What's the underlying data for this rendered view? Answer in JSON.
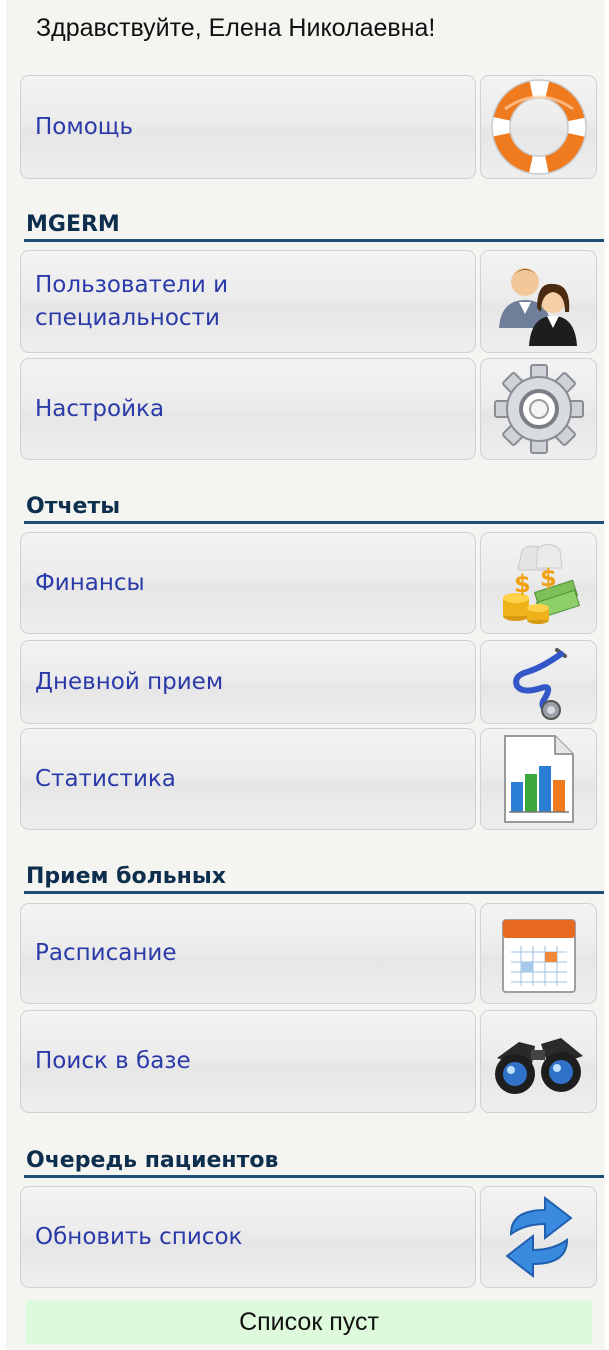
{
  "greeting": "Здравствуйте, Елена Николаевна!",
  "help": {
    "label": "Помощь",
    "icon": "lifebuoy-icon"
  },
  "sections": {
    "mgerm": {
      "title": "MGERM",
      "users": {
        "label": "Пользователи и специальности",
        "icon": "users-icon"
      },
      "settings": {
        "label": "Настройка",
        "icon": "gear-icon"
      }
    },
    "reports": {
      "title": "Отчеты",
      "finance": {
        "label": "Финансы",
        "icon": "money-icon"
      },
      "daily": {
        "label": "Дневной прием",
        "icon": "stethoscope-icon"
      },
      "stats": {
        "label": "Статистика",
        "icon": "bar-chart-icon"
      }
    },
    "reception": {
      "title": "Прием больных",
      "schedule": {
        "label": "Расписание",
        "icon": "calendar-icon"
      },
      "search": {
        "label": "Поиск в базе",
        "icon": "binoculars-icon"
      }
    },
    "queue": {
      "title": "Очередь пациентов",
      "refresh": {
        "label": "Обновить список",
        "icon": "refresh-icon"
      },
      "status": "Список пуст"
    }
  },
  "colors": {
    "link": "#2a3aa8",
    "section_title": "#0e2e4e",
    "section_rule": "#1f4f74",
    "status_bg": "#ddfadd"
  }
}
